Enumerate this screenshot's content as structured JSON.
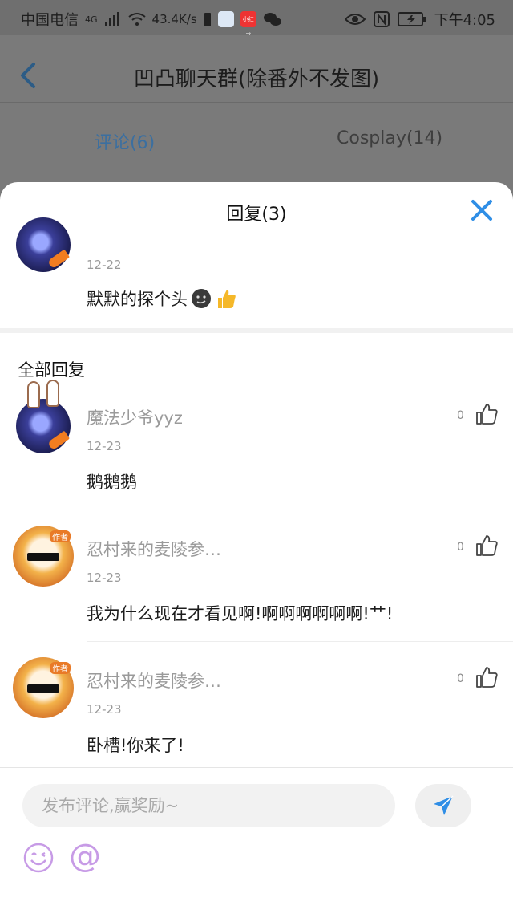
{
  "status_bar": {
    "carrier": "中国电信",
    "network": "4G",
    "speed": "43.4K/s",
    "time": "下午4:05",
    "app_badge_text": "小红书"
  },
  "header": {
    "title": "凹凸聊天群(除番外不发图)",
    "tabs": [
      {
        "label": "评论(6)"
      },
      {
        "label": "Cosplay(14)"
      }
    ]
  },
  "sheet": {
    "title": "回复(3)",
    "original_comment": {
      "date": "12-22",
      "text": "默默的探个头"
    },
    "section_label": "全部回复",
    "replies": [
      {
        "name": "魔法少爷yyz",
        "date": "12-23",
        "text": "鹅鹅鹅",
        "likes": "0"
      },
      {
        "name": "忍村来的麦陵参…",
        "date": "12-23",
        "text": "我为什么现在才看见啊!啊啊啊啊啊啊!艹!",
        "likes": "0",
        "badge": "作者"
      },
      {
        "name": "忍村来的麦陵参…",
        "date": "12-23",
        "text": "卧槽!你来了!",
        "likes": "0",
        "badge": "作者"
      }
    ]
  },
  "composer": {
    "placeholder": "发布评论,赢奖励~"
  },
  "colors": {
    "accent": "#2f8ee6",
    "send_icon": "#2f8ee6",
    "emoji_purple": "#c79be6"
  },
  "icons": [
    "back-chevron-icon",
    "close-icon",
    "thumb-up-icon",
    "send-icon",
    "emoji-icon",
    "at-icon"
  ]
}
